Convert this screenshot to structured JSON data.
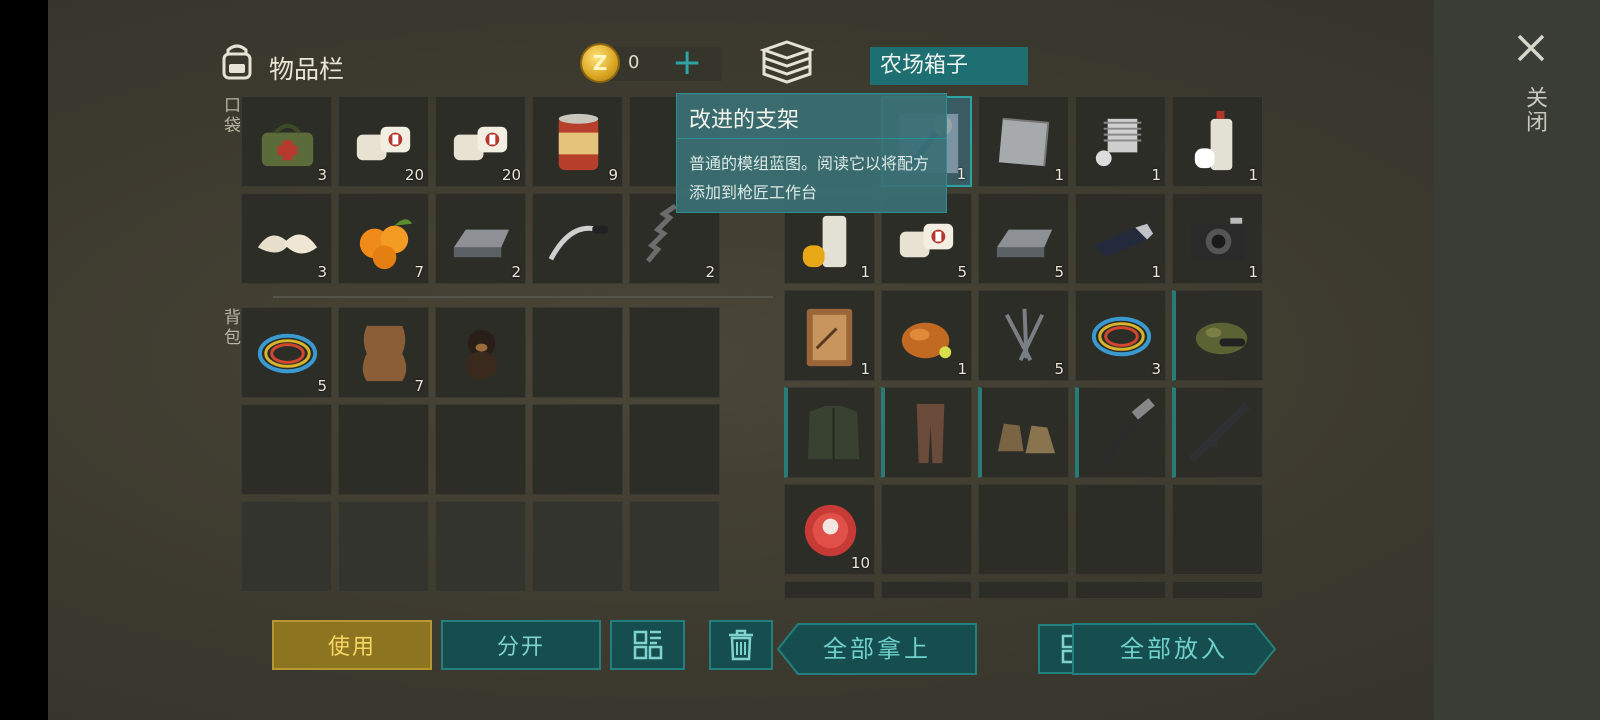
{
  "inventory": {
    "title": "物品栏",
    "pocket_label": "口袋",
    "backpack_label": "背包"
  },
  "currency": {
    "value": "0",
    "plus": "+",
    "coin_letter": "Z"
  },
  "container": {
    "title": "农场箱子"
  },
  "close": {
    "glyph": "✕",
    "label": "关闭"
  },
  "tooltip": {
    "title": "改进的支架",
    "body": "普通的模组蓝图。阅读它以将配方添加到枪匠工作台"
  },
  "pocket_items": [
    {
      "icon": "medical-bag-icon",
      "count": "3"
    },
    {
      "icon": "bandage-icon",
      "count": "20"
    },
    {
      "icon": "bandage-icon",
      "count": "20"
    },
    {
      "icon": "canned-food-icon",
      "count": "9"
    },
    {
      "icon": "hidden-item-icon",
      "count": ""
    },
    {
      "icon": "dumplings-icon",
      "count": "3"
    },
    {
      "icon": "kumquat-icon",
      "count": "7"
    },
    {
      "icon": "iron-ingot-icon",
      "count": "2"
    },
    {
      "icon": "handlebar-icon",
      "count": ""
    },
    {
      "icon": "spring-icon",
      "count": "2"
    }
  ],
  "backpack_items": [
    {
      "icon": "wire-coil-icon",
      "count": "5"
    },
    {
      "icon": "animal-hide-icon",
      "count": "7"
    },
    {
      "icon": "puppy-icon",
      "count": ""
    }
  ],
  "box_items": [
    {
      "icon": "hidden-item-icon",
      "count": ""
    },
    {
      "icon": "blueprint-icon",
      "count": "1"
    },
    {
      "icon": "metal-plate-icon",
      "count": "1"
    },
    {
      "icon": "engine-cylinder-icon",
      "count": "1"
    },
    {
      "icon": "spray-paint-icon",
      "count": "1"
    },
    {
      "icon": "paint-can-icon",
      "count": "1"
    },
    {
      "icon": "bandage-icon",
      "count": "5"
    },
    {
      "icon": "iron-ingot-icon",
      "count": "5"
    },
    {
      "icon": "usb-drive-icon",
      "count": "1"
    },
    {
      "icon": "camera-icon",
      "count": "1"
    },
    {
      "icon": "diary-icon",
      "count": "1"
    },
    {
      "icon": "roast-chicken-icon",
      "count": "1"
    },
    {
      "icon": "nails-icon",
      "count": "5"
    },
    {
      "icon": "wire-coil-icon",
      "count": "3"
    },
    {
      "icon": "camo-cap-icon",
      "count": ""
    },
    {
      "icon": "jacket-icon",
      "count": ""
    },
    {
      "icon": "pants-icon",
      "count": ""
    },
    {
      "icon": "boots-icon",
      "count": ""
    },
    {
      "icon": "hammer-icon",
      "count": ""
    },
    {
      "icon": "rifle-icon",
      "count": ""
    },
    {
      "icon": "bottle-cap-icon",
      "count": "10"
    }
  ],
  "buttons": {
    "use": "使用",
    "split": "分开",
    "take_all": "全部拿上",
    "put_all": "全部放入"
  },
  "colors": {
    "accent": "#2aa5a3",
    "use_button": "#8d7420",
    "panel": "#2d2d28"
  }
}
